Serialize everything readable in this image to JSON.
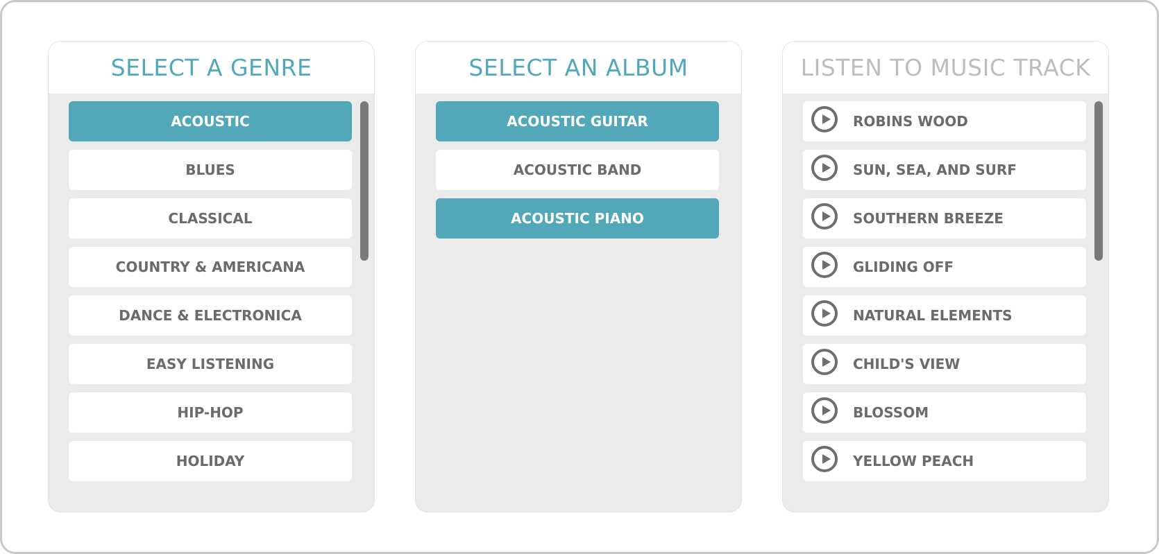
{
  "genre_panel": {
    "title": "SELECT A GENRE",
    "items": [
      {
        "label": "ACOUSTIC",
        "selected": true
      },
      {
        "label": "BLUES",
        "selected": false
      },
      {
        "label": "CLASSICAL",
        "selected": false
      },
      {
        "label": "COUNTRY & AMERICANA",
        "selected": false
      },
      {
        "label": "DANCE & ELECTRONICA",
        "selected": false
      },
      {
        "label": "EASY LISTENING",
        "selected": false
      },
      {
        "label": "HIP-HOP",
        "selected": false
      },
      {
        "label": "HOLIDAY",
        "selected": false
      }
    ]
  },
  "album_panel": {
    "title": "SELECT AN ALBUM",
    "items": [
      {
        "label": "ACOUSTIC GUITAR",
        "selected": true
      },
      {
        "label": "ACOUSTIC BAND",
        "selected": false
      },
      {
        "label": "ACOUSTIC PIANO",
        "selected": true
      }
    ]
  },
  "track_panel": {
    "title": "LISTEN TO MUSIC TRACK",
    "items": [
      {
        "label": "ROBINS WOOD",
        "icon": "play-circle-icon"
      },
      {
        "label": "SUN, SEA, AND SURF",
        "icon": "play-circle-icon"
      },
      {
        "label": "SOUTHERN BREEZE",
        "icon": "play-circle-icon"
      },
      {
        "label": "GLIDING OFF",
        "icon": "play-circle-icon"
      },
      {
        "label": "NATURAL ELEMENTS",
        "icon": "play-circle-icon"
      },
      {
        "label": "CHILD'S VIEW",
        "icon": "play-circle-icon"
      },
      {
        "label": "BLOSSOM",
        "icon": "play-circle-icon"
      },
      {
        "label": "YELLOW PEACH",
        "icon": "play-circle-icon"
      }
    ]
  },
  "colors": {
    "accent": "#52a8b8",
    "item_text": "#6b6b6b",
    "inactive_title": "#bdbdbd",
    "panel_bg": "#ebebeb"
  }
}
